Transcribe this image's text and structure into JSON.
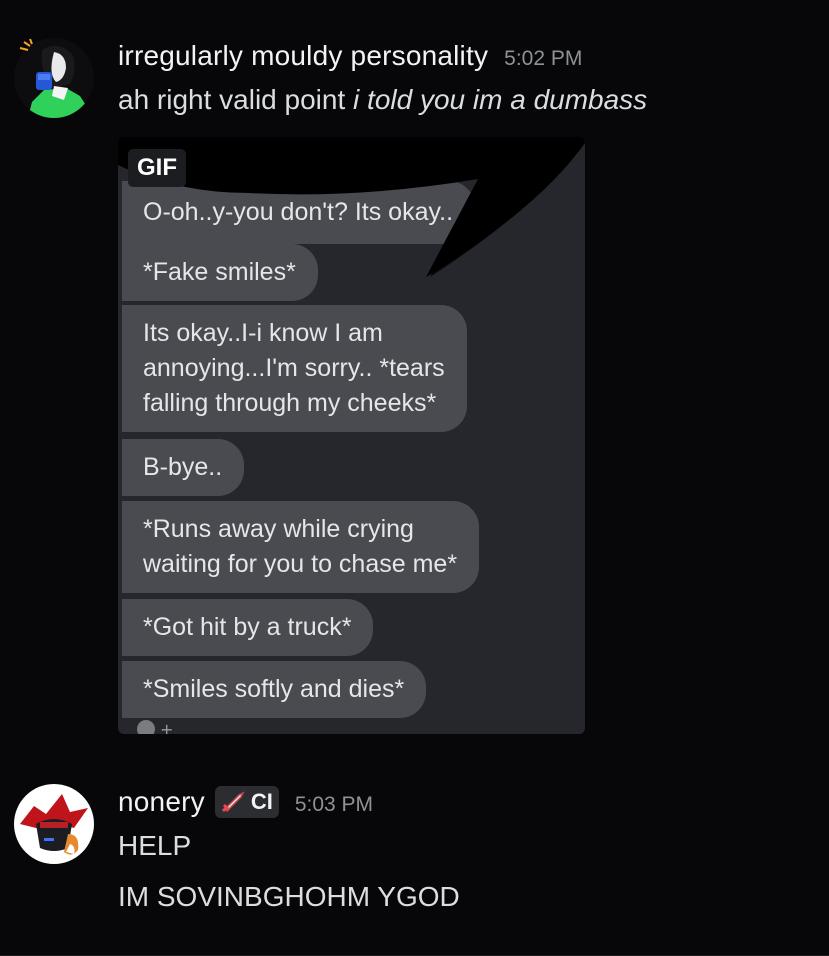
{
  "messages": [
    {
      "username": "irregularly mouldy personality",
      "timestamp": "5:02 PM",
      "text_plain": "ah right valid point ",
      "text_italic": "i told you im a dumbass",
      "gif": {
        "badge": "GIF",
        "bubbles": [
          "O-oh..y-you don't? Its okay..",
          "*Fake smiles*",
          "Its okay..I-i know I am",
          "annoying...I'm sorry.. *tears",
          "falling through my cheeks*",
          "B-bye..",
          "*Runs away while crying",
          "waiting for you to chase me*",
          "*Got hit by a truck*",
          "*Smiles softly and dies*"
        ]
      }
    },
    {
      "username": "nonery",
      "tag": "CI",
      "tag_icon": "sword-icon",
      "timestamp": "5:03 PM",
      "lines": [
        "HELP",
        "IM SOVINBGHOHM YGOD"
      ]
    }
  ],
  "colors": {
    "background": "#070709",
    "username": "#f2f3f5",
    "timestamp": "#8e9297",
    "bubble": "#494b51",
    "gif_bg": "#25272c"
  }
}
